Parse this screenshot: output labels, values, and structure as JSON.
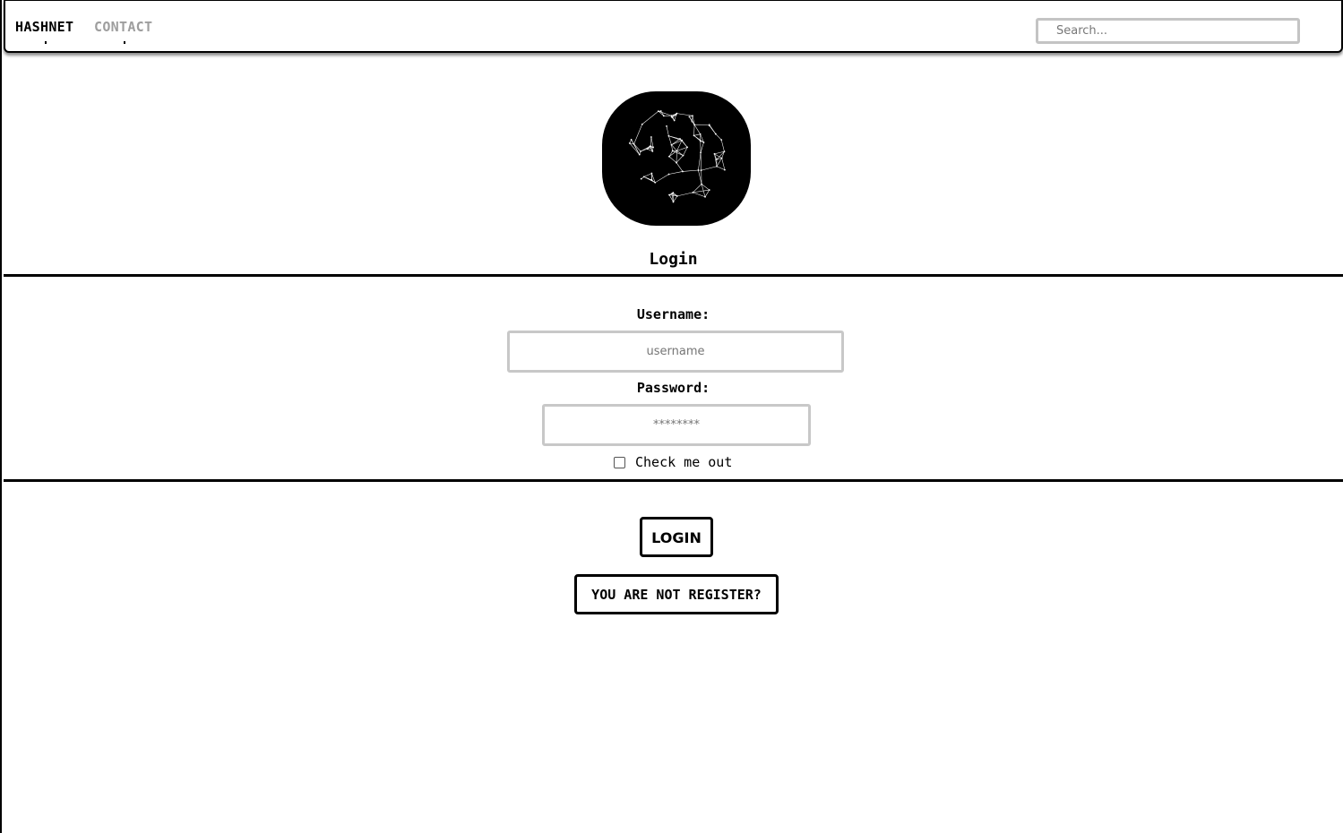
{
  "navbar": {
    "links": [
      {
        "label": "HASHNET"
      },
      {
        "label": "CONTACT"
      }
    ],
    "search_placeholder": "Search..."
  },
  "logo": {
    "icon": "network-mesh-icon",
    "background": "#000000",
    "stroke": "#ffffff"
  },
  "form": {
    "title": "Login",
    "username_label": "Username:",
    "username_placeholder": "username",
    "username_value": "",
    "password_label": "Password:",
    "password_placeholder": "********",
    "password_value": "",
    "checkbox_label": "Check me out",
    "checkbox_checked": false
  },
  "actions": {
    "login_label": "LOGIN",
    "register_label": "YOU ARE NOT REGISTER?"
  },
  "colors": {
    "active_link": "#000000",
    "inactive_link": "#9e9e9e",
    "input_border": "#c8c8c8"
  }
}
